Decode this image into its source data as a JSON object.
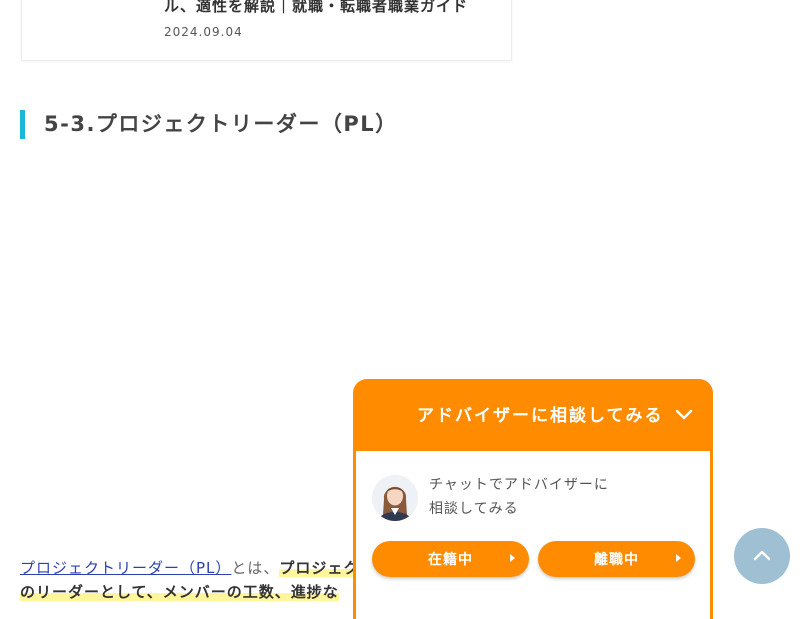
{
  "related_card": {
    "title": "ル、適性を解説｜就職・転職者職業ガイド",
    "date": "2024.09.04"
  },
  "section_heading": "5-3.プロジェクトリーダー（PL）",
  "paragraph": {
    "link_text": "プロジェクトリーダー（PL）",
    "connector": "とは、",
    "highlight_line1": "プロジェク",
    "highlight_line2": "のリーダーとして、メンバーの工数、進捗な"
  },
  "chat_widget": {
    "title": "アドバイザーに相談してみる",
    "message_line1": "チャットでアドバイザーに",
    "message_line2": "相談してみる",
    "button_employed": "在籍中",
    "button_unemployed": "離職中",
    "accent_color": "#ff8c00"
  },
  "icons": {
    "collapse": "chevron-down-icon",
    "back_to_top": "chevron-up-icon",
    "avatar": "advisor-avatar"
  }
}
